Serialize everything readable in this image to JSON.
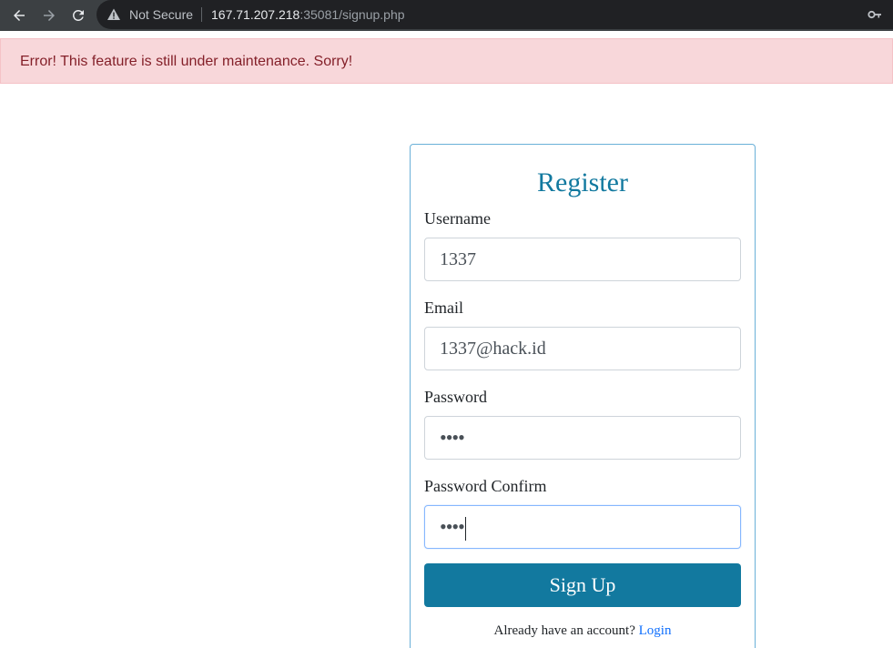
{
  "browser": {
    "security_label": "Not Secure",
    "url_host": "167.71.207.218",
    "url_rest": ":35081/signup.php",
    "icons": [
      "back-icon",
      "forward-icon",
      "reload-icon",
      "warning-icon",
      "key-icon"
    ]
  },
  "alert": {
    "message": "Error! This feature is still under maintenance. Sorry!",
    "color": "#842029",
    "background": "#f8d7da"
  },
  "form": {
    "title": "Register",
    "fields": [
      {
        "label": "Username",
        "value": "1337",
        "type": "text"
      },
      {
        "label": "Email",
        "value": "1337@hack.id",
        "type": "text"
      },
      {
        "label": "Password",
        "value": "••••",
        "type": "password"
      },
      {
        "label": "Password Confirm",
        "value": "••••",
        "type": "password"
      }
    ],
    "submit_label": "Sign Up",
    "footer_text": "Already have an account?",
    "login_link": "Login",
    "accent_color": "#12799f"
  }
}
